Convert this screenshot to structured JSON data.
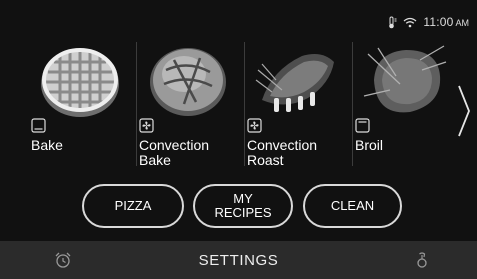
{
  "status": {
    "time": "11:00",
    "ampm": "AM"
  },
  "modes": [
    {
      "label": "Bake",
      "icon": "bake-mode-icon"
    },
    {
      "label": "Convection\nBake",
      "icon": "convection-fan-icon"
    },
    {
      "label": "Convection\nRoast",
      "icon": "convection-fan-icon"
    },
    {
      "label": "Broil",
      "icon": "broil-mode-icon"
    }
  ],
  "buttons": {
    "pizza": "PIZZA",
    "my_recipes": "MY\nRECIPES",
    "clean": "CLEAN"
  },
  "bottom_bar": {
    "settings": "SETTINGS"
  }
}
